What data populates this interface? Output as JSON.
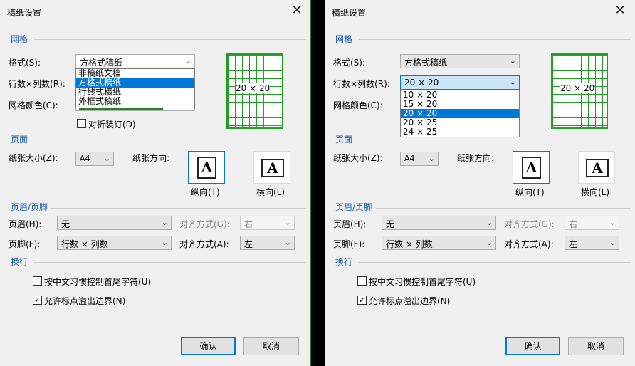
{
  "dialog_title": "稿纸设置",
  "close_glyph": "✕",
  "sections": {
    "grid": "网格",
    "page": "页面",
    "header_footer": "页眉/页脚",
    "line_break": "换行"
  },
  "labels": {
    "format": "格式(S):",
    "rows_cols": "行数×列数(R):",
    "grid_color": "网格颜色(C):",
    "fold_binding": "对折装订(D)",
    "paper_size": "纸张大小(Z):",
    "orientation": "纸张方向:",
    "portrait": "纵向(T)",
    "landscape": "横向(L)",
    "header": "页眉(H):",
    "footer": "页脚(F):",
    "align_header": "对齐方式(G):",
    "align_footer": "对齐方式(A):",
    "cjk_control": "按中文习惯控制首尾字符(U)",
    "punct_overflow": "允许标点溢出边界(N)"
  },
  "preview_glyph": "A",
  "values": {
    "format": "方格式稿纸",
    "rows_cols": "20 × 20",
    "paper_size": "A4",
    "header": "无",
    "header_align": "右",
    "footer": "行数 × 列数",
    "footer_align": "左",
    "grid_preview_label": "20 × 20"
  },
  "checkboxes": {
    "fold_binding": false,
    "cjk_control": false,
    "punct_overflow": true
  },
  "check_glyph": "✓",
  "arrow_glyph": "⌄",
  "format_options": [
    "非稿纸文档",
    "方格式稿纸",
    "行线式稿纸",
    "外框式稿纸"
  ],
  "format_selected_index": 1,
  "rows_cols_options": [
    "10 × 20",
    "15 × 20",
    "20 × 20",
    "20 × 25",
    "24 × 25"
  ],
  "rows_cols_selected_index": 2,
  "buttons": {
    "ok": "确认",
    "cancel": "取消"
  },
  "colors": {
    "accent": "#0078d7",
    "grid_green": "#22a022",
    "section_blue": "#1a5fb4"
  }
}
